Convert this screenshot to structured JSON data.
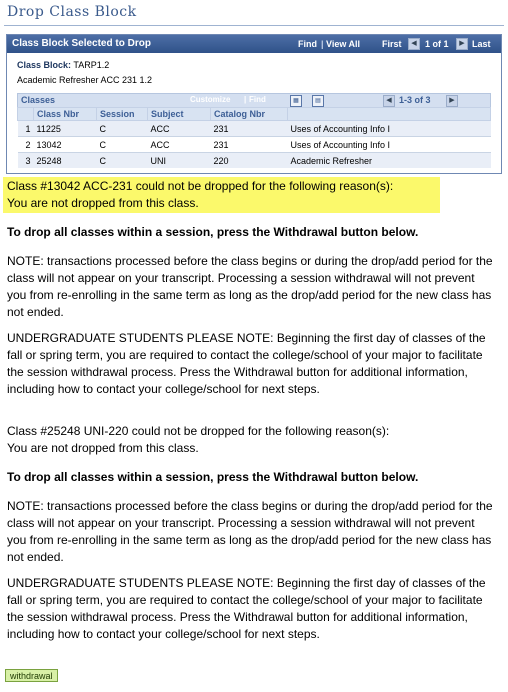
{
  "page": {
    "title": "Drop Class Block"
  },
  "panel": {
    "title": "Class Block Selected to Drop",
    "find": "Find",
    "view_all": "View All",
    "first": "First",
    "pager": "1 of 1",
    "last": "Last",
    "class_block_label": "Class Block:",
    "class_block_value": "TARP1.2",
    "description": "Academic Refresher ACC 231 1.2"
  },
  "classes_grid": {
    "title": "Classes",
    "customize": "Customize",
    "find": "Find",
    "pager": "1-3 of 3",
    "columns": [
      "Class Nbr",
      "Session",
      "Subject",
      "Catalog Nbr",
      ""
    ],
    "rows": [
      {
        "row_num": "1",
        "class_nbr": "11225",
        "session": "C",
        "subject": "ACC",
        "catalog_nbr": "231",
        "title": "Uses of Accounting Info I"
      },
      {
        "row_num": "2",
        "class_nbr": "13042",
        "session": "C",
        "subject": "ACC",
        "catalog_nbr": "231",
        "title": "Uses of Accounting Info I"
      },
      {
        "row_num": "3",
        "class_nbr": "25248",
        "session": "C",
        "subject": "UNI",
        "catalog_nbr": "220",
        "title": "Academic Refresher"
      }
    ]
  },
  "messages": {
    "error1_line1": "Class #13042 ACC-231 could not be dropped for the following reason(s):",
    "error1_line2": "You are not dropped from this class.",
    "drop_all_1": "To drop all classes within a session, press the Withdrawal button below.",
    "note_1": "NOTE: transactions processed before the class begins or during the drop/add period for the class will not appear on your transcript. Processing a session withdrawal will not prevent you from re-enrolling in the same term as long as the drop/add period for the new class has not ended.",
    "undergrad_1": "UNDERGRADUATE STUDENTS PLEASE NOTE: Beginning the first day of classes of the fall or spring term, you are required to contact the college/school of your major to facilitate the session withdrawal process. Press the Withdrawal button for additional information, including how to contact your college/school for next steps.",
    "error2_line1": "Class #25248 UNI-220 could not be dropped for the following reason(s):",
    "error2_line2": "You are not dropped from this class.",
    "drop_all_2": "To drop all classes within a session, press the Withdrawal button below.",
    "note_2": "NOTE: transactions processed before the class begins or during the drop/add period for the class will not appear on your transcript. Processing a session withdrawal will not prevent you from re-enrolling in the same term as long as the drop/add period for the new class has not ended.",
    "undergrad_2": "UNDERGRADUATE STUDENTS PLEASE NOTE: Beginning the first day of classes of the fall or spring term, you are required to contact the college/school of your major to facilitate the session withdrawal process. Press the Withdrawal button for additional information, including how to contact your college/school for next steps."
  },
  "withdrawal_button": "withdrawal",
  "colors": {
    "header_blue": "#2f5289",
    "highlight_yellow": "#fbf96b",
    "button_green": "#d8f0a6"
  }
}
